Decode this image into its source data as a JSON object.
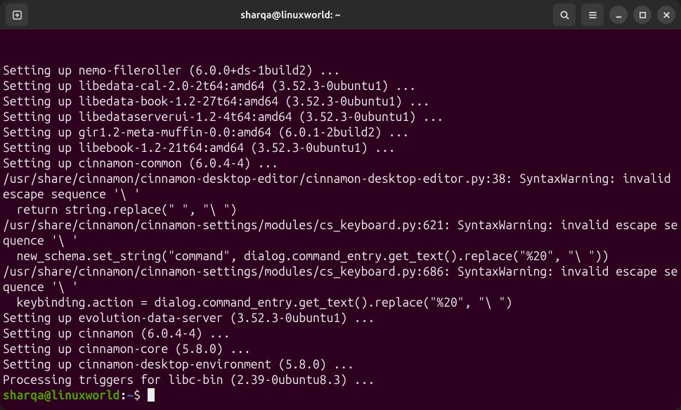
{
  "titlebar": {
    "title": "sharqa@linuxworld: ~"
  },
  "terminal": {
    "lines": [
      "Setting up nemo-fileroller (6.0.0+ds-1build2) ...",
      "Setting up libedata-cal-2.0-2t64:amd64 (3.52.3-0ubuntu1) ...",
      "Setting up libedata-book-1.2-27t64:amd64 (3.52.3-0ubuntu1) ...",
      "Setting up libedataserverui-1.2-4t64:amd64 (3.52.3-0ubuntu1) ...",
      "Setting up gir1.2-meta-muffin-0.0:amd64 (6.0.1-2build2) ...",
      "Setting up libebook-1.2-21t64:amd64 (3.52.3-0ubuntu1) ...",
      "Setting up cinnamon-common (6.0.4-4) ...",
      "/usr/share/cinnamon/cinnamon-desktop-editor/cinnamon-desktop-editor.py:38: SyntaxWarning: invalid escape sequence '\\ '",
      "  return string.replace(\" \", \"\\ \")",
      "/usr/share/cinnamon/cinnamon-settings/modules/cs_keyboard.py:621: SyntaxWarning: invalid escape sequence '\\ '",
      "  new_schema.set_string(\"command\", dialog.command_entry.get_text().replace(\"%20\", \"\\ \"))",
      "/usr/share/cinnamon/cinnamon-settings/modules/cs_keyboard.py:686: SyntaxWarning: invalid escape sequence '\\ '",
      "  keybinding.action = dialog.command_entry.get_text().replace(\"%20\", \"\\ \")",
      "Setting up evolution-data-server (3.52.3-0ubuntu1) ...",
      "Setting up cinnamon (6.0.4-4) ...",
      "Setting up cinnamon-core (5.8.0) ...",
      "Setting up cinnamon-desktop-environment (5.8.0) ...",
      "Processing triggers for libc-bin (2.39-0ubuntu8.3) ..."
    ],
    "prompt": {
      "user_host": "sharqa@linuxworld",
      "colon": ":",
      "path": "~",
      "symbol": "$"
    }
  }
}
